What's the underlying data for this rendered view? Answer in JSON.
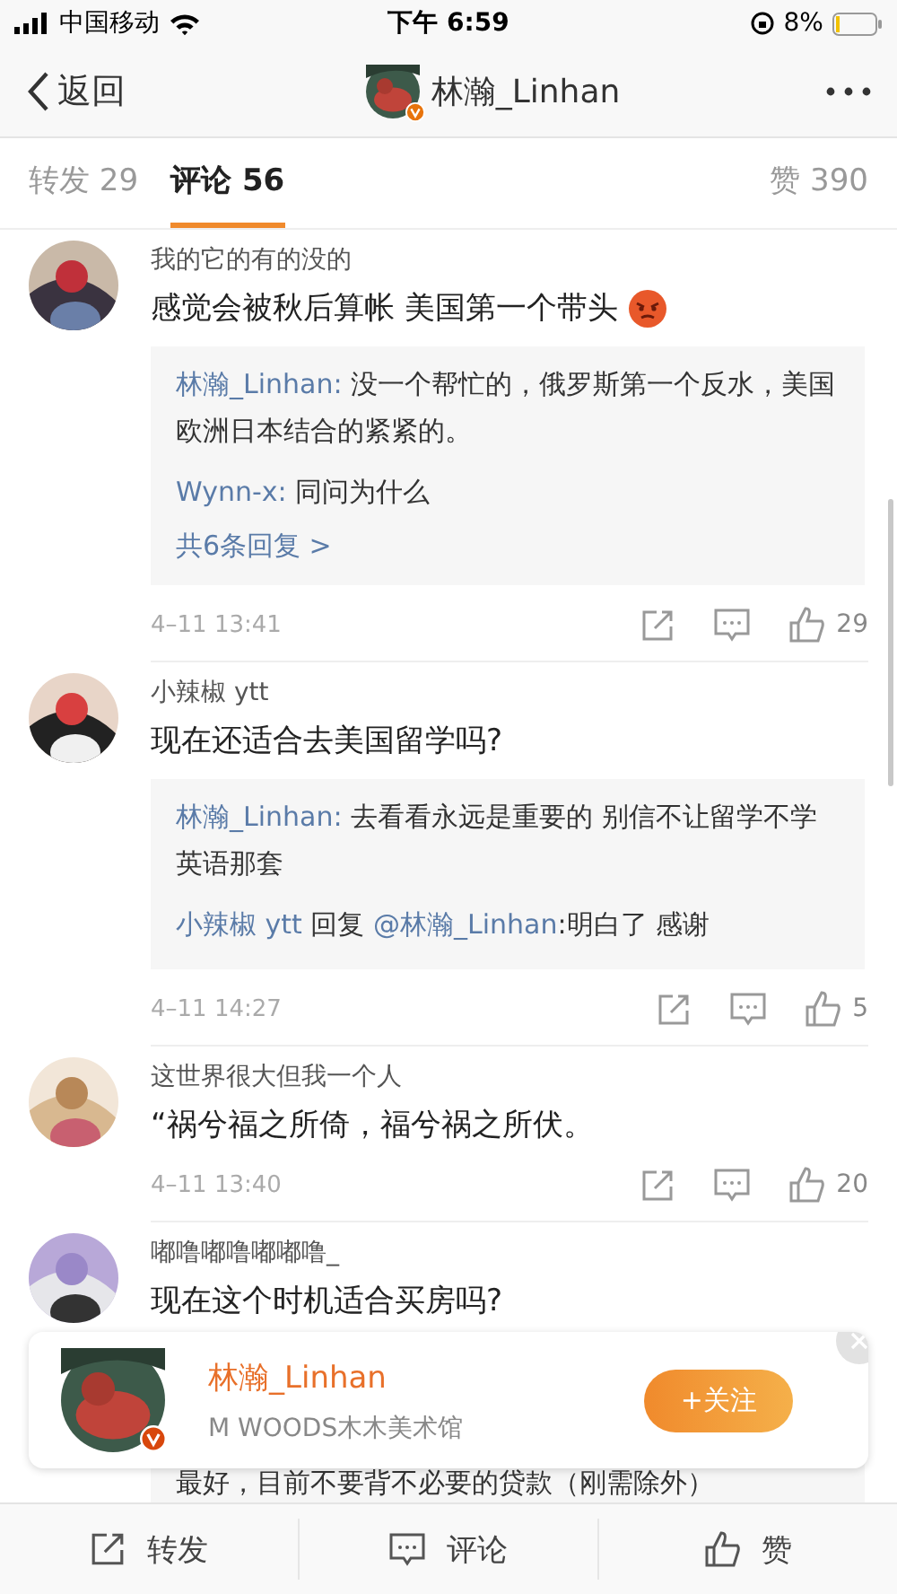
{
  "status_bar": {
    "carrier": "中国移动",
    "time": "下午 6:59",
    "battery": "8%"
  },
  "nav": {
    "back": "返回",
    "title": "林瀚_Linhan"
  },
  "tabs": [
    {
      "label": "转发 29",
      "selected": false
    },
    {
      "label": "评论 56",
      "selected": true
    },
    {
      "label": "赞 390",
      "selected": false
    }
  ],
  "comments": [
    {
      "name": "我的它的有的没的",
      "text": "感觉会被秋后算帐 美国第一个带头",
      "has_emoji": true,
      "replies": [
        {
          "author": "林瀚_Linhan:",
          "text": " 没一个帮忙的，俄罗斯第一个反水，美国欧洲日本结合的紧紧的。"
        },
        {
          "author": "Wynn-x:",
          "text": " 同问为什么"
        }
      ],
      "more_replies": "共6条回复 >",
      "time": "4–11 13:41",
      "likes": "29"
    },
    {
      "name": "小辣椒 ytt",
      "text": "现在还适合去美国留学吗?",
      "has_emoji": false,
      "replies": [
        {
          "author": "林瀚_Linhan:",
          "text": " 去看看永远是重要的 别信不让留学不学英语那套"
        },
        {
          "author": "小辣椒 ytt",
          "verb": " 回复 ",
          "mention": "@林瀚_Linhan",
          "text": ":明白了 感谢"
        }
      ],
      "time": "4–11 14:27",
      "likes": "5"
    },
    {
      "name": "这世界很大但我一个人",
      "text": "“祸兮福之所倚，福兮祸之所伏。",
      "has_emoji": false,
      "time": "4–11 13:40",
      "likes": "20"
    },
    {
      "name": "嘟噜嘟噜嘟嘟噜_",
      "text": "现在这个时机适合买房吗?",
      "has_emoji": false,
      "replies": [
        {
          "text": "最好，目前不要背不必要的贷款（刚需除外）"
        }
      ]
    }
  ],
  "follow_popup": {
    "name": "林瀚_Linhan",
    "subtitle": "M WOODS木木美术馆",
    "button": "+关注"
  },
  "bottom_bar": [
    {
      "kind": "repost",
      "label": "转发"
    },
    {
      "kind": "comment",
      "label": "评论"
    },
    {
      "kind": "like",
      "label": "赞"
    }
  ]
}
